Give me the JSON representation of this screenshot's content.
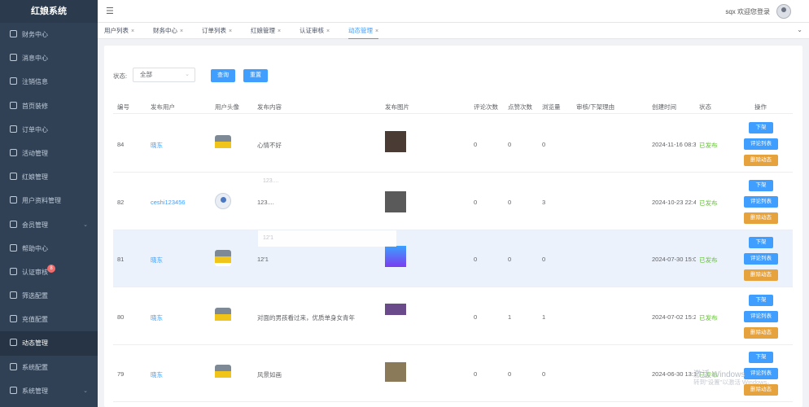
{
  "app": {
    "brand": "红娘系统"
  },
  "sidebar": {
    "items": [
      {
        "label": "财务中心",
        "icon": "wallet-icon"
      },
      {
        "label": "消息中心",
        "icon": "message-icon"
      },
      {
        "label": "注销信息",
        "icon": "document-icon"
      },
      {
        "label": "首页装修",
        "icon": "home-icon"
      },
      {
        "label": "订单中心",
        "icon": "order-icon"
      },
      {
        "label": "活动管理",
        "icon": "calendar-icon"
      },
      {
        "label": "红娘管理",
        "icon": "user-icon"
      },
      {
        "label": "用户资料管理",
        "icon": "profile-icon"
      },
      {
        "label": "会员管理",
        "icon": "member-icon",
        "chevron": "⌄"
      },
      {
        "label": "帮助中心",
        "icon": "help-icon"
      },
      {
        "label": "认证审核",
        "icon": "verify-icon",
        "badge": "8"
      },
      {
        "label": "筛选配置",
        "icon": "filter-icon"
      },
      {
        "label": "充值配置",
        "icon": "recharge-icon"
      },
      {
        "label": "动态管理",
        "icon": "moments-icon",
        "active": true
      },
      {
        "label": "系统配置",
        "icon": "list-icon"
      },
      {
        "label": "系统管理",
        "icon": "settings-icon",
        "chevron": "⌄"
      }
    ]
  },
  "navbar": {
    "greeting": "sqx 欢迎您登录"
  },
  "tags": [
    {
      "label": "用户列表"
    },
    {
      "label": "财务中心"
    },
    {
      "label": "订单列表"
    },
    {
      "label": "红娘管理"
    },
    {
      "label": "认证审核"
    },
    {
      "label": "动态管理",
      "active": true
    }
  ],
  "filter": {
    "status_label": "状态:",
    "status_value": "全部",
    "query_btn": "查询",
    "reset_btn": "重置"
  },
  "table": {
    "headers": [
      "编号",
      "发布用户",
      "用户头像",
      "发布内容",
      "发布图片",
      "评论次数",
      "点赞次数",
      "浏览量",
      "审核/下架理由",
      "创建时间",
      "状态",
      "操作"
    ],
    "rows": [
      {
        "id": "84",
        "user": "晓东",
        "avatar": "car",
        "content": "心情不好",
        "image_color": "#4a3b35",
        "comments": "0",
        "likes": "0",
        "views": "0",
        "reason": "",
        "time": "2024-11-16 08:3",
        "status": "已发布"
      },
      {
        "id": "82",
        "user": "ceshi123456",
        "avatar": "person",
        "content": "123....",
        "image_color": "#5a5a5a",
        "comments": "0",
        "likes": "0",
        "views": "3",
        "reason": "",
        "time": "2024-10-23 22:4",
        "status": "已发布"
      },
      {
        "id": "81",
        "user": "晓东",
        "avatar": "car",
        "content": "12'1",
        "image_color": "#4b7cff",
        "comments": "0",
        "likes": "0",
        "views": "0",
        "reason": "",
        "time": "2024-07-30 15:0",
        "status": "已发布"
      },
      {
        "id": "80",
        "user": "晓东",
        "avatar": "car",
        "content": "对面的男孩看过来，优质单身女青年",
        "image_color": "#6a4a8a",
        "comments": "0",
        "likes": "1",
        "views": "1",
        "reason": "",
        "time": "2024-07-02 15:2",
        "status": "已发布"
      },
      {
        "id": "79",
        "user": "晓东",
        "avatar": "car",
        "content": "风景如画",
        "image_color": "#8a7a5a",
        "comments": "0",
        "likes": "0",
        "views": "0",
        "reason": "",
        "time": "2024-06-30 13:1",
        "status": "已发布"
      }
    ],
    "actions": {
      "off": "下架",
      "comments": "评论列表",
      "delete": "删除动态"
    }
  },
  "tooltips": [
    "123....",
    "12'1"
  ],
  "watermark": {
    "line1": "激活 Windows",
    "line2": "转到\"设置\"以激活 Windows。"
  }
}
